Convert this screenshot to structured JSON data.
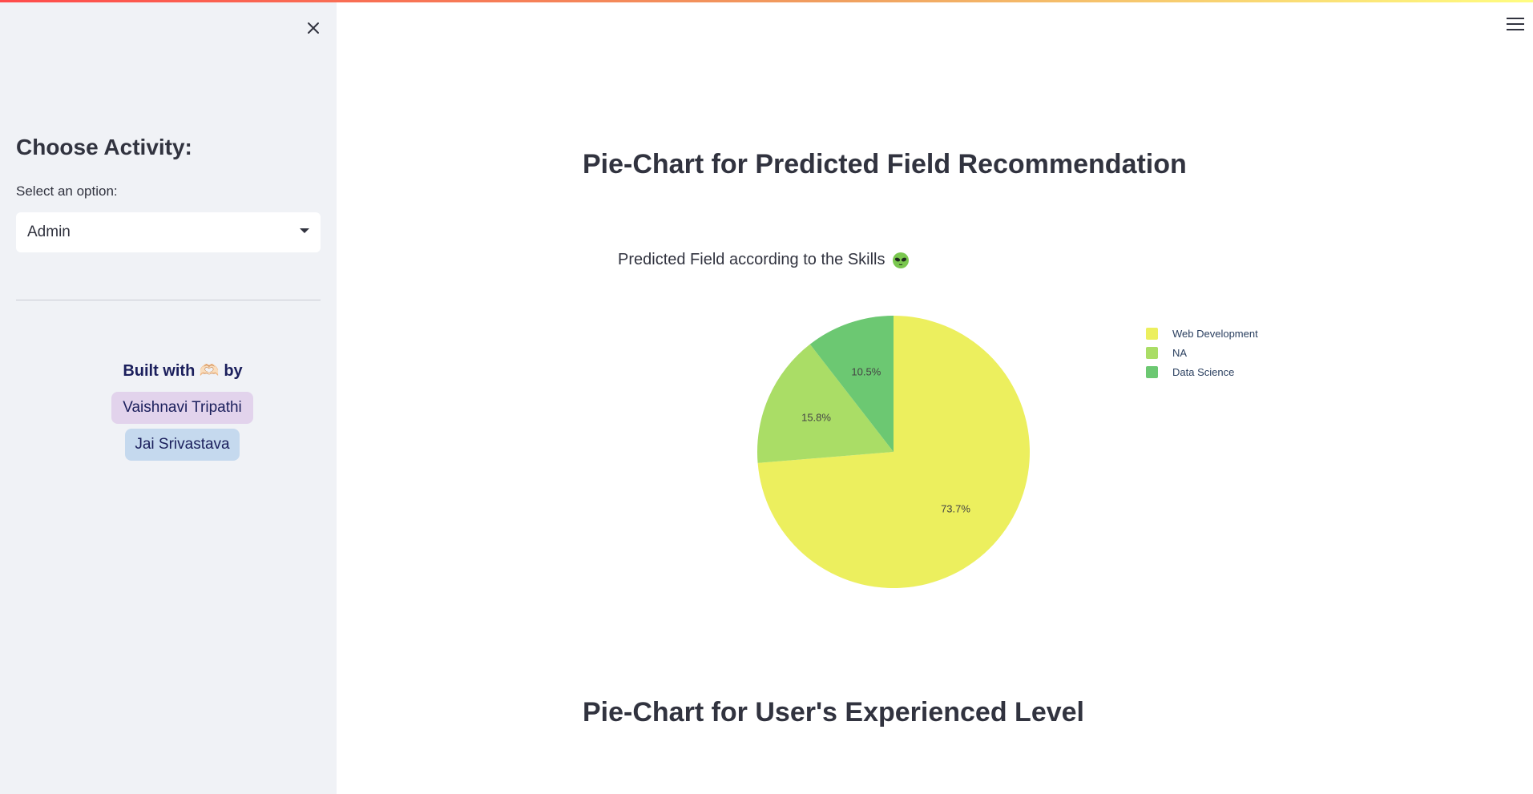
{
  "sidebar": {
    "heading": "Choose Activity:",
    "select_label": "Select an option:",
    "select_value": "Admin",
    "built_with_prefix": "Built with",
    "built_with_emoji": "🫶🏻",
    "built_with_suffix": "by",
    "authors": [
      "Vaishnavi Tripathi",
      "Jai Srivastava"
    ]
  },
  "icons": {
    "close": "close-icon",
    "menu": "hamburger-menu-icon",
    "caret": "chevron-down-icon",
    "alien": "alien-face-icon"
  },
  "main": {
    "title": "Pie-Chart for Predicted Field Recommendation",
    "second_title": "Pie-Chart for User's Experienced Level"
  },
  "chart_data": {
    "type": "pie",
    "title": "Predicted Field according to the Skills",
    "labels": [
      "Web Development",
      "NA",
      "Data Science"
    ],
    "values": [
      73.7,
      15.8,
      10.5
    ],
    "value_labels": [
      "73.7%",
      "15.8%",
      "10.5%"
    ],
    "colors": [
      "#ecef5e",
      "#aadd66",
      "#6cc872"
    ],
    "legend_position": "right"
  }
}
